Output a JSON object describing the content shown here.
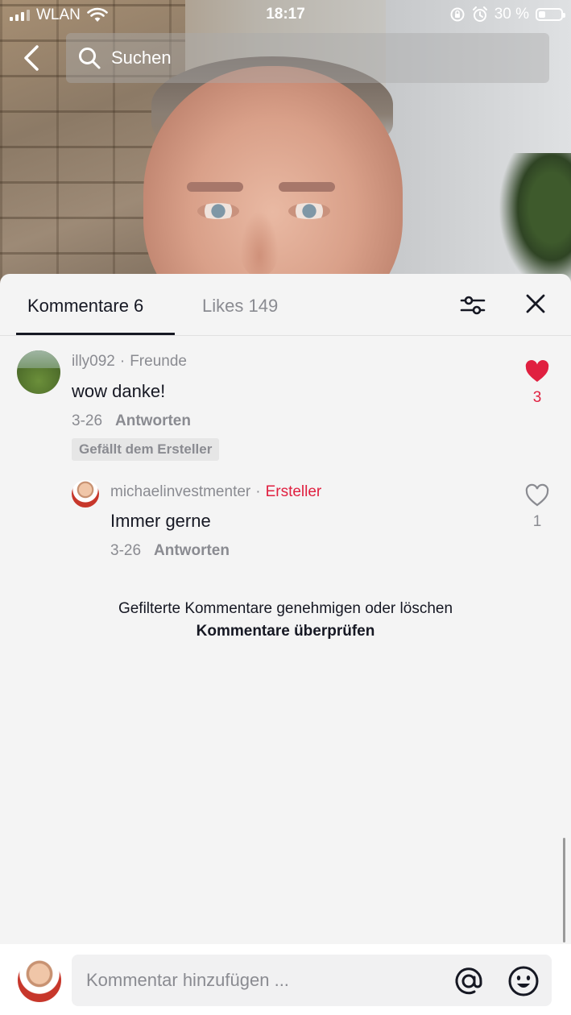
{
  "status_bar": {
    "carrier": "WLAN",
    "time": "18:17",
    "battery_percent": "30 %",
    "battery_level": 0.3
  },
  "search": {
    "placeholder": "Suchen"
  },
  "tabs": [
    {
      "label": "Kommentare 6",
      "active": true
    },
    {
      "label": "Likes 149",
      "active": false
    }
  ],
  "comments": [
    {
      "user": "illy092",
      "relation": "Freunde",
      "text": "wow danke!",
      "date": "3-26",
      "reply_label": "Antworten",
      "creator_badge": "Gefällt dem Ersteller",
      "likes": "3",
      "liked": true,
      "replies": [
        {
          "user": "michaelinvestmenter",
          "role": "Ersteller",
          "text": "Immer gerne",
          "date": "3-26",
          "reply_label": "Antworten",
          "likes": "1",
          "liked": false
        }
      ]
    }
  ],
  "filter_notice": {
    "text": "Gefilterte Kommentare genehmigen oder löschen",
    "link": "Kommentare überprüfen"
  },
  "composer": {
    "placeholder": "Kommentar hinzufügen ..."
  },
  "colors": {
    "accent_red": "#e02040",
    "text_primary": "#161823",
    "text_secondary": "#8a8b91"
  }
}
